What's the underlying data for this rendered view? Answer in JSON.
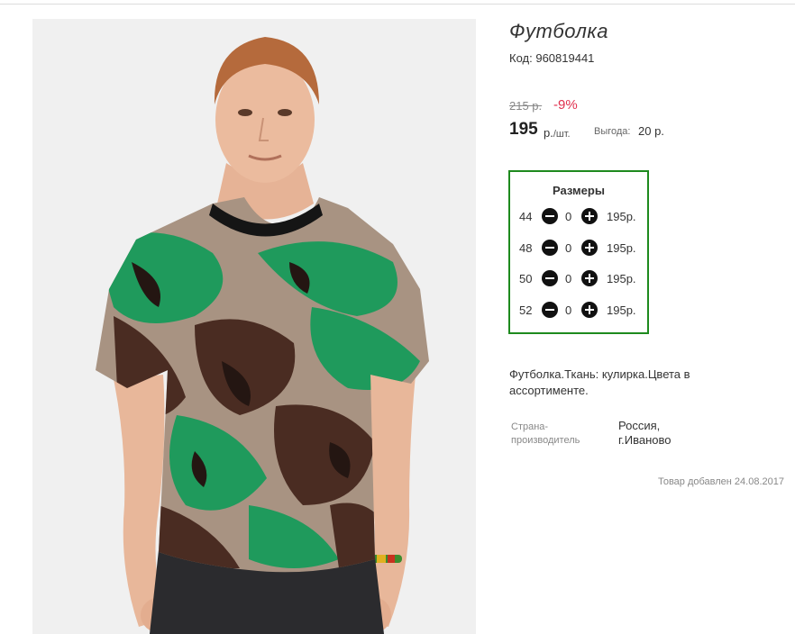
{
  "product": {
    "title": "Футболка",
    "code_label": "Код:",
    "code": "960819441",
    "old_price": "215 р.",
    "discount": "-9%",
    "price": "195",
    "unit_currency": "р.",
    "unit_per": "/шт.",
    "benefit_label": "Выгода:",
    "benefit_value": "20 р.",
    "image_alt": "Футболка"
  },
  "sizes": {
    "title": "Размеры",
    "rows": [
      {
        "size": "44",
        "qty": "0",
        "price": "195р."
      },
      {
        "size": "48",
        "qty": "0",
        "price": "195р."
      },
      {
        "size": "50",
        "qty": "0",
        "price": "195р."
      },
      {
        "size": "52",
        "qty": "0",
        "price": "195р."
      }
    ]
  },
  "description": "Футболка.Ткань: кулирка.Цвета в ассортименте.",
  "country": {
    "label": "Страна-производитель",
    "value": "Россия, г.Иваново"
  },
  "added": "Товар добавлен 24.08.2017",
  "colors": {
    "accent_border": "#1e8a1e",
    "discount": "#e0304e",
    "camo_green": "#1f9a5c",
    "camo_brown": "#4a2c22",
    "camo_tan": "#a89382"
  }
}
